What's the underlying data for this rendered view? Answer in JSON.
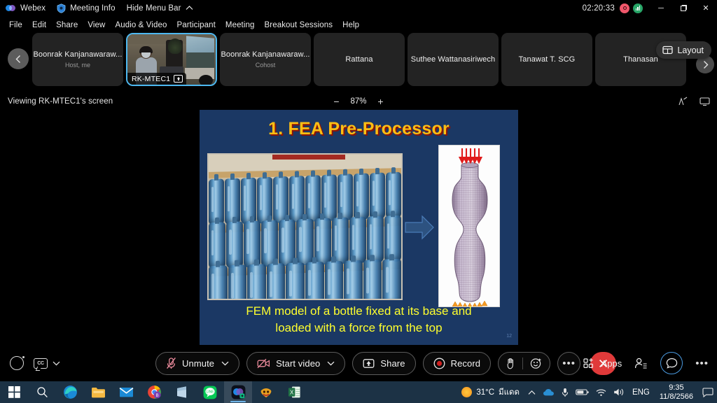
{
  "titlebar": {
    "app_name": "Webex",
    "meeting_info": "Meeting Info",
    "hide_menu_bar": "Hide Menu Bar",
    "timer": "02:20:33",
    "recording_icon": "record-indicator-icon",
    "signal_icon": "network-signal-icon",
    "minimize": "─",
    "maximize": "❐",
    "close": "✕"
  },
  "menubar": {
    "items": [
      {
        "label": "File"
      },
      {
        "label": "Edit"
      },
      {
        "label": "Share"
      },
      {
        "label": "View"
      },
      {
        "label": "Audio & Video"
      },
      {
        "label": "Participant"
      },
      {
        "label": "Meeting"
      },
      {
        "label": "Breakout Sessions"
      },
      {
        "label": "Help"
      }
    ]
  },
  "filmstrip": {
    "prev_label": "‹",
    "next_label": "›",
    "layout_label": "Layout",
    "tiles": [
      {
        "name": "Boonrak Kanjanawaraw...",
        "role": "Host, me",
        "type": "avatar"
      },
      {
        "name": "RK-MTEC1",
        "role": "",
        "type": "video",
        "active": true,
        "sharing": true
      },
      {
        "name": "Boonrak Kanjanawaraw...",
        "role": "Cohost",
        "type": "avatar"
      },
      {
        "name": "Rattana",
        "role": "",
        "type": "avatar"
      },
      {
        "name": "Suthee Wattanasiriwech",
        "role": "",
        "type": "avatar"
      },
      {
        "name": "Tanawat T. SCG",
        "role": "",
        "type": "avatar"
      },
      {
        "name": "Thanasan",
        "role": "",
        "type": "avatar"
      }
    ]
  },
  "viewbar": {
    "viewing_text": "Viewing RK-MTEC1's screen",
    "zoom_out": "−",
    "zoom_value": "87%",
    "zoom_in": "+",
    "annotate_icon": "annotate-pen-icon",
    "display_icon": "monitor-icon"
  },
  "slide": {
    "title": "1. FEA Pre-Processor",
    "caption_line1": "FEM model of a bottle fixed at its base and",
    "caption_line2": "loaded with a force from the top",
    "page_number": "12",
    "photo_alt": "warehouse-shelves-of-blue-water-bottles",
    "fem_alt": "fem-mesh-bottle-model",
    "arrow_alt": "right-arrow-graphic",
    "colors": {
      "background": "#1b3864",
      "title": "#fdbe13",
      "title_shadow": "#8a1408",
      "caption": "#ffff2e"
    }
  },
  "controlbar": {
    "mute_label": "Unmute",
    "video_label": "Start video",
    "share_label": "Share",
    "record_label": "Record",
    "apps_label": "Apps",
    "chevron": "⌄",
    "more_label": "•••",
    "leave_label": "✕",
    "icons": {
      "circle": "video-thumbnail-toggle-icon",
      "cc": "closed-captions-icon",
      "mic_off": "microphone-muted-icon",
      "camera_off": "camera-off-icon",
      "share": "share-screen-icon",
      "record": "record-icon",
      "raise_hand": "raise-hand-icon",
      "reactions": "reactions-emoji-icon",
      "apps": "apps-grid-icon",
      "participants": "participants-icon",
      "chat": "chat-bubble-icon",
      "more": "more-options-icon"
    }
  },
  "taskbar": {
    "items": [
      {
        "name": "start-button",
        "active": false
      },
      {
        "name": "search-button",
        "active": false
      },
      {
        "name": "edge-browser",
        "active": false,
        "running": true
      },
      {
        "name": "file-explorer",
        "active": false,
        "running": true
      },
      {
        "name": "mail-app",
        "active": false,
        "running": true
      },
      {
        "name": "chrome-browser",
        "active": false,
        "running": true
      },
      {
        "name": "onenote-app",
        "active": false,
        "running": true
      },
      {
        "name": "line-app",
        "active": false,
        "running": true
      },
      {
        "name": "webex-app",
        "active": true,
        "running": true
      },
      {
        "name": "orange-app",
        "active": false,
        "running": true
      },
      {
        "name": "excel-app",
        "active": false,
        "running": true
      }
    ],
    "tray": {
      "weather_temp": "31°C",
      "weather_desc": "มีแดด",
      "chevron_up": "∧",
      "onedrive_icon": "onedrive-cloud-icon",
      "mic_icon": "microphone-icon",
      "battery_icon": "battery-icon",
      "wifi_icon": "wifi-icon",
      "volume_icon": "volume-icon",
      "language": "ENG",
      "time": "9:35",
      "date": "11/8/2566",
      "notification_icon": "notification-chat-icon"
    }
  }
}
